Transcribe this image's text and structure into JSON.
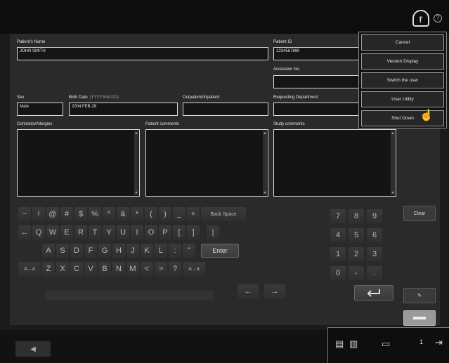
{
  "form": {
    "patient_name_label": "Patient's Name",
    "patient_name_value": "JOHN SMITH",
    "patient_id_label": "Patient ID",
    "patient_id_value": "1234567890",
    "accession_label": "Accession No.",
    "accession_value": "",
    "sex_label": "Sex",
    "sex_value": "Male",
    "birth_label": "Birth Date",
    "birth_format": "(YYYY.MM.DD)",
    "birth_value": "2004.FEB.28",
    "outpatient_label": "Outpatient/Inpatient",
    "outpatient_value": "",
    "department_label": "Requesting Department",
    "department_value": "",
    "contrast_label": "Contrasts/Allergies",
    "patient_comments_label": "Patient comments",
    "study_comments_label": "Study comments"
  },
  "keyboard": {
    "row1": [
      "~",
      "!",
      "@",
      "#",
      "$",
      "%",
      "^",
      "&",
      "*",
      "(",
      ")",
      "_",
      "+",
      "Back Space"
    ],
    "row2": [
      "←",
      "Q",
      "W",
      "E",
      "R",
      "T",
      "Y",
      "U",
      "I",
      "O",
      "P",
      "[",
      "]",
      "|"
    ],
    "row3": [
      "A",
      "S",
      "D",
      "F",
      "G",
      "H",
      "J",
      "K",
      "L",
      ":",
      "\"",
      "Enter"
    ],
    "row4": [
      "A→a",
      "Z",
      "X",
      "C",
      "V",
      "B",
      "N",
      "M",
      "<",
      ">",
      "?",
      "A→a"
    ],
    "row5": [
      "←",
      "→"
    ]
  },
  "numpad": {
    "rows": [
      [
        "7",
        "8",
        "9"
      ],
      [
        "4",
        "5",
        "6"
      ],
      [
        "1",
        "2",
        "3"
      ],
      [
        "0",
        "-",
        "."
      ]
    ]
  },
  "side": {
    "clear_label": "Clear"
  },
  "menu": {
    "items": [
      "Cancel",
      "Version Display",
      "Switch the user",
      "User Utility",
      "Shut Down"
    ]
  },
  "tray": {
    "count": "1"
  },
  "colors": {
    "panel": "#2a2a2a",
    "field": "#151515",
    "accent_button": "#9a9a9a"
  }
}
